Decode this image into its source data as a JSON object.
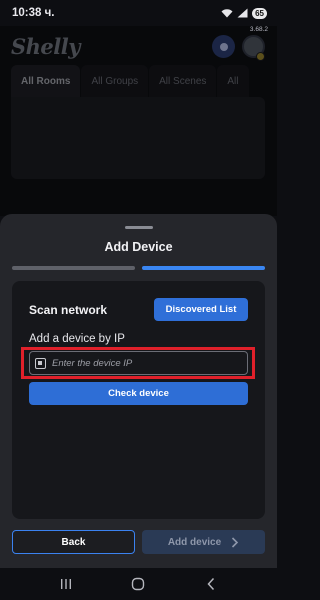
{
  "status_bar": {
    "time": "10:38 ч.",
    "battery": "65",
    "version": "3.68.2"
  },
  "background_app": {
    "logo": "Shelly",
    "tabs": [
      {
        "label": "All Rooms",
        "active": true
      },
      {
        "label": "All Groups",
        "active": false
      },
      {
        "label": "All Scenes",
        "active": false
      },
      {
        "label": "All",
        "active": false
      }
    ],
    "icons": [
      "settings-icon",
      "avatar"
    ]
  },
  "sheet": {
    "title": "Add Device",
    "steps": [
      {
        "state": "done"
      },
      {
        "state": "current"
      }
    ],
    "scan_label": "Scan network",
    "discovered_button": "Discovered List",
    "add_by_ip_label": "Add a device by IP",
    "ip_field": {
      "value": "",
      "placeholder": "Enter the device IP",
      "icon": "chip-icon",
      "highlighted": true
    },
    "check_button": "Check device",
    "back_button": "Back",
    "add_device_button": "Add device"
  },
  "colors": {
    "accent": "#3a86f2",
    "button_blue": "#2f6fd8",
    "highlight_red": "#e0202a",
    "sheet_bg": "#25262b",
    "card_bg": "#16171b"
  },
  "nav_bar": {
    "icons": [
      "recents-icon",
      "home-icon",
      "back-icon"
    ]
  }
}
